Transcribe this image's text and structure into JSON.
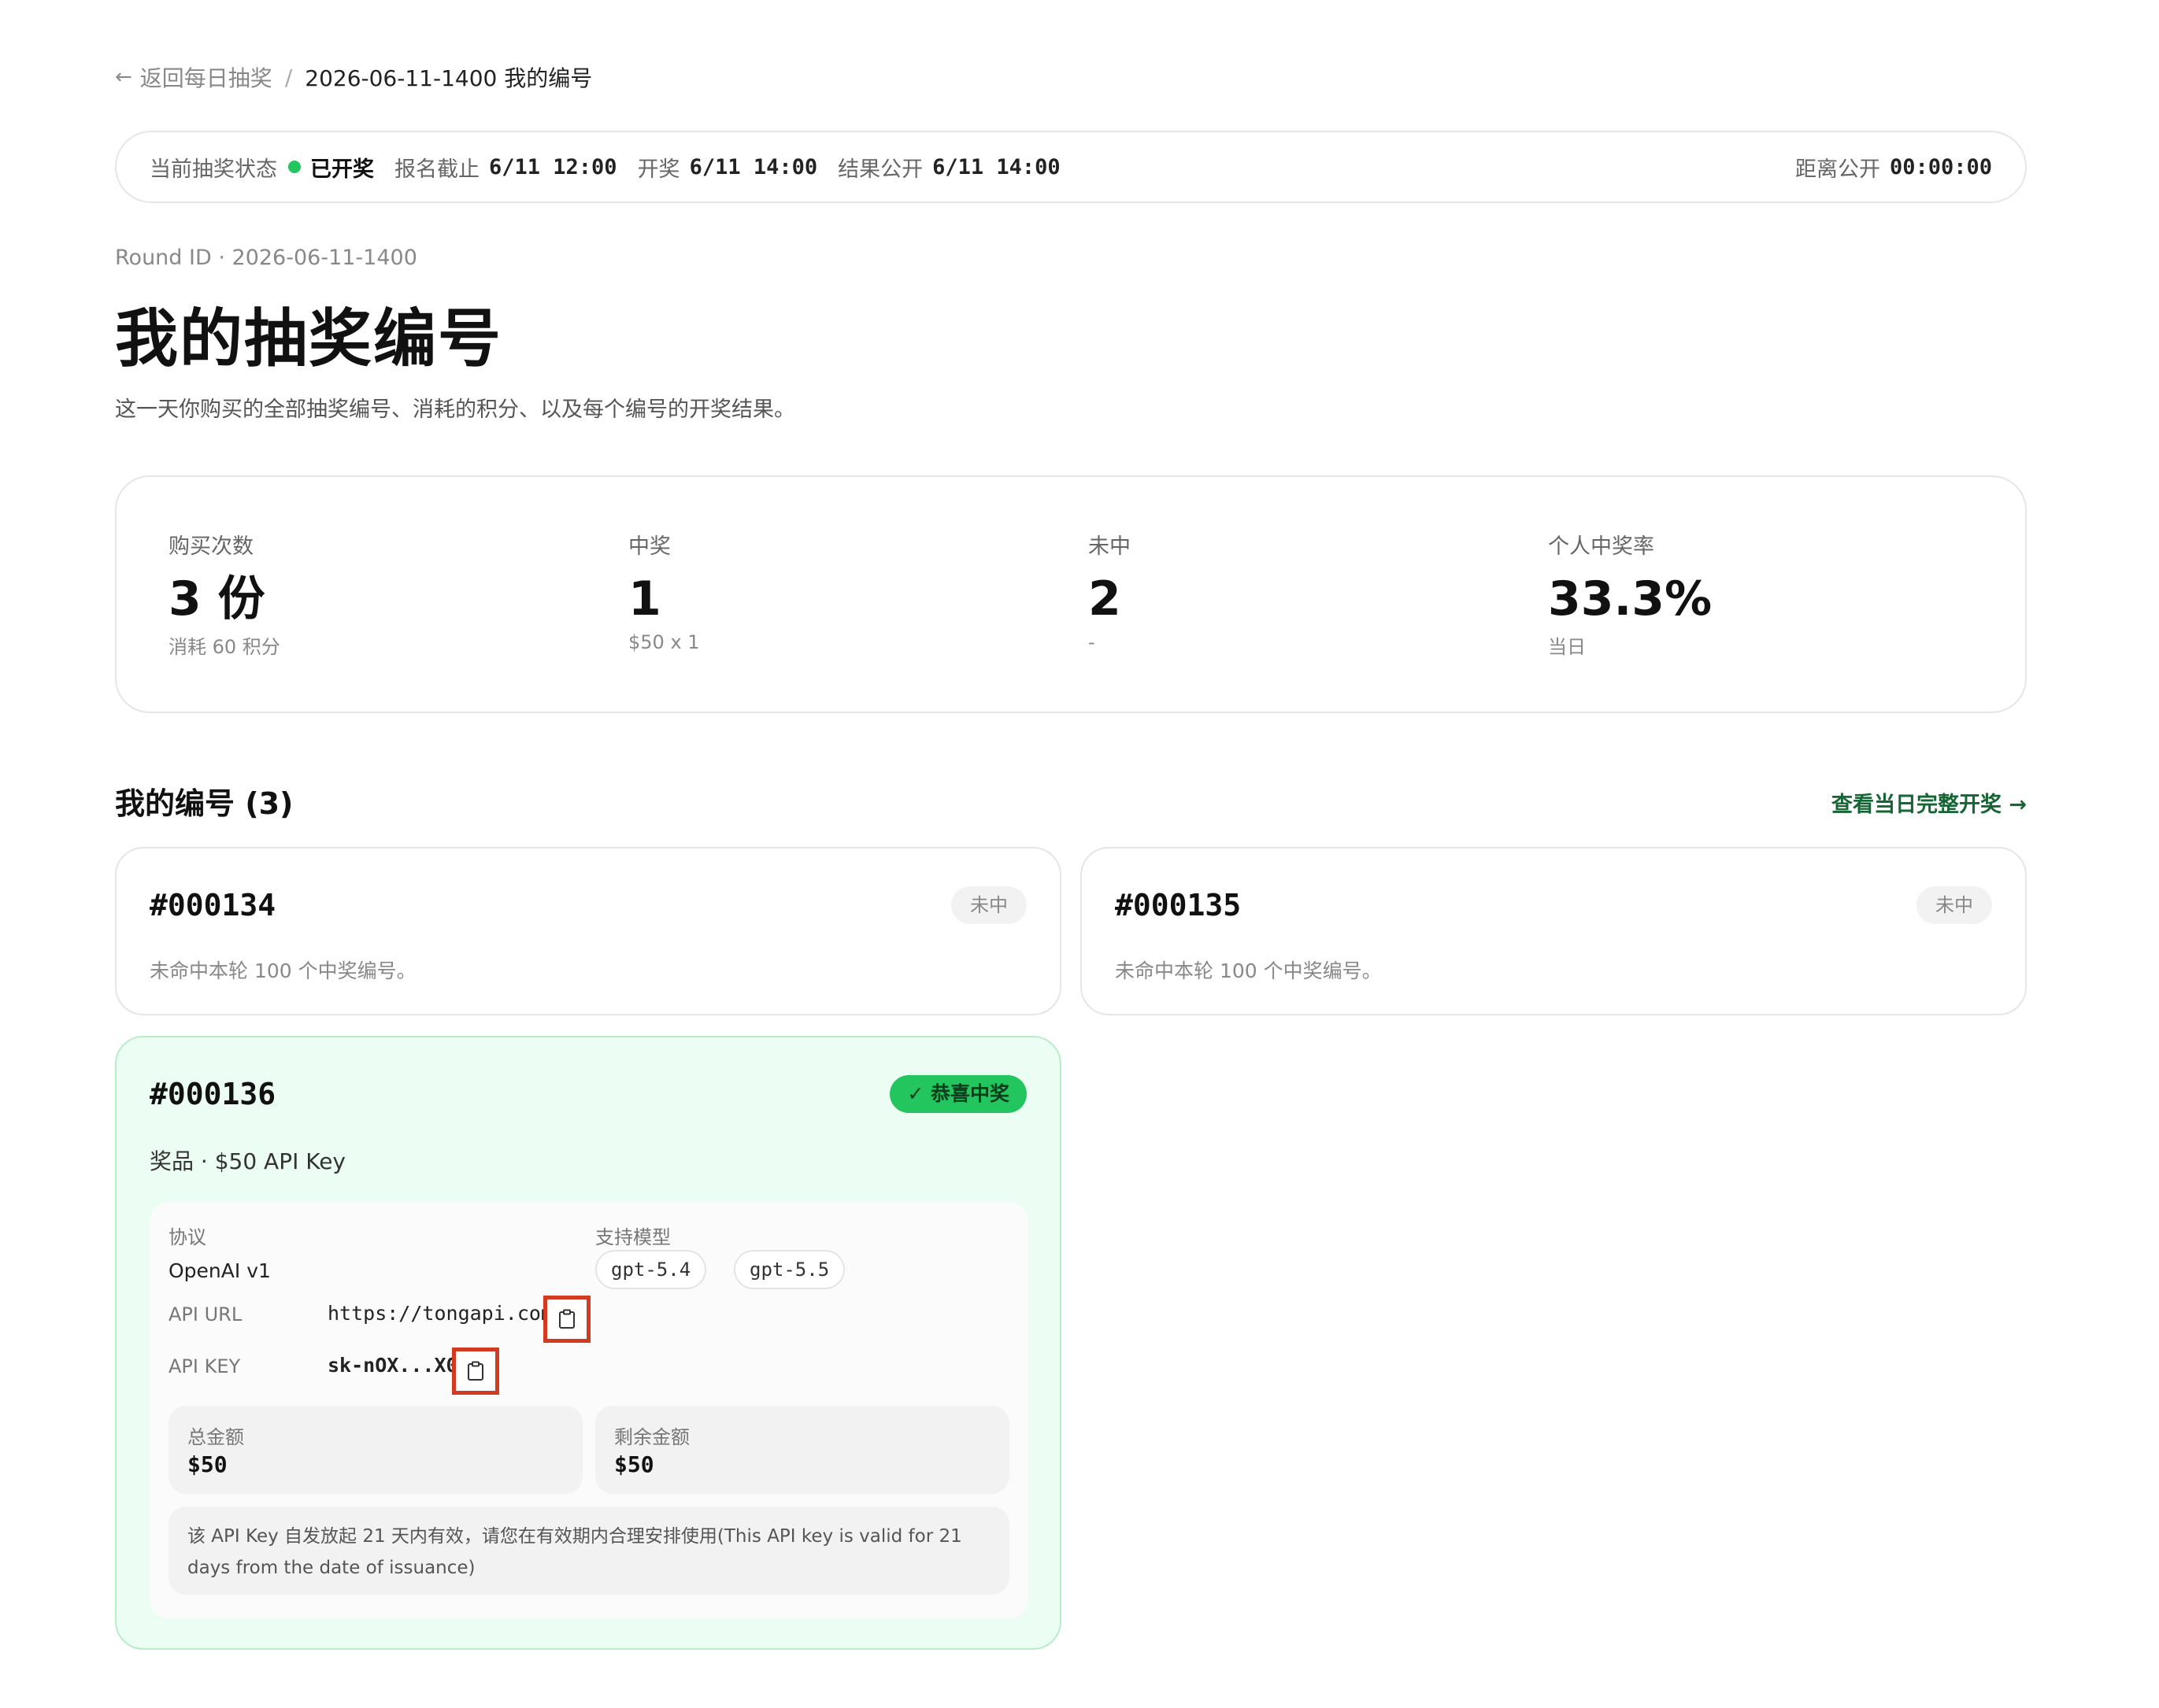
{
  "breadcrumb": {
    "back_label": "返回每日抽奖",
    "separator": "/",
    "current": "2026-06-11-1400 我的编号"
  },
  "status_bar": {
    "state_label": "当前抽奖状态",
    "state_value": "已开奖",
    "state_color": "#22c55e",
    "signup_label": "报名截止",
    "signup_value": "6/11 12:00",
    "draw_label": "开奖",
    "draw_value": "6/11 14:00",
    "publish_label": "结果公开",
    "publish_value": "6/11 14:00",
    "countdown_label": "距离公开",
    "countdown_value": "00:00:00"
  },
  "header": {
    "round_id": "Round ID · 2026-06-11-1400",
    "title": "我的抽奖编号",
    "subtitle": "这一天你购买的全部抽奖编号、消耗的积分、以及每个编号的开奖结果。"
  },
  "stats": [
    {
      "label": "购买次数",
      "value": "3 份",
      "note": "消耗 60 积分"
    },
    {
      "label": "中奖",
      "value": "1",
      "note": "$50 x 1"
    },
    {
      "label": "未中",
      "value": "2",
      "note": "-"
    },
    {
      "label": "个人中奖率",
      "value": "33.3%",
      "note": "当日"
    }
  ],
  "section": {
    "title": "我的编号 (3)",
    "link": "查看当日完整开奖 →"
  },
  "tickets": [
    {
      "number": "#000134",
      "badge": "未中",
      "description": "未命中本轮 100 个中奖编号。"
    },
    {
      "number": "#000135",
      "badge": "未中",
      "description": "未命中本轮 100 个中奖编号。"
    },
    {
      "number": "#000136",
      "badge": "恭喜中奖",
      "prize": "奖品 · $50 API Key",
      "protocol_label": "协议",
      "protocol_value": "OpenAI v1",
      "models_label": "支持模型",
      "models": [
        "gpt-5.4",
        "gpt-5.5"
      ],
      "api_url_label": "API URL",
      "api_url_value": "https://tongapi.com",
      "api_key_label": "API KEY",
      "api_key_value": "sk-nOX...X0",
      "total_label": "总金额",
      "total_value": "$50",
      "remaining_label": "剩余金额",
      "remaining_value": "$50",
      "notice": "该 API Key 自发放起 21 天内有效，请您在有效期内合理安排使用(This API key is valid for 21 days from the date of issuance)",
      "accent_color": "#22c55e"
    }
  ],
  "icons": {
    "back": "arrow-left-icon",
    "check": "check-icon",
    "copy": "clipboard-icon",
    "status_dot": "status-dot-icon"
  }
}
